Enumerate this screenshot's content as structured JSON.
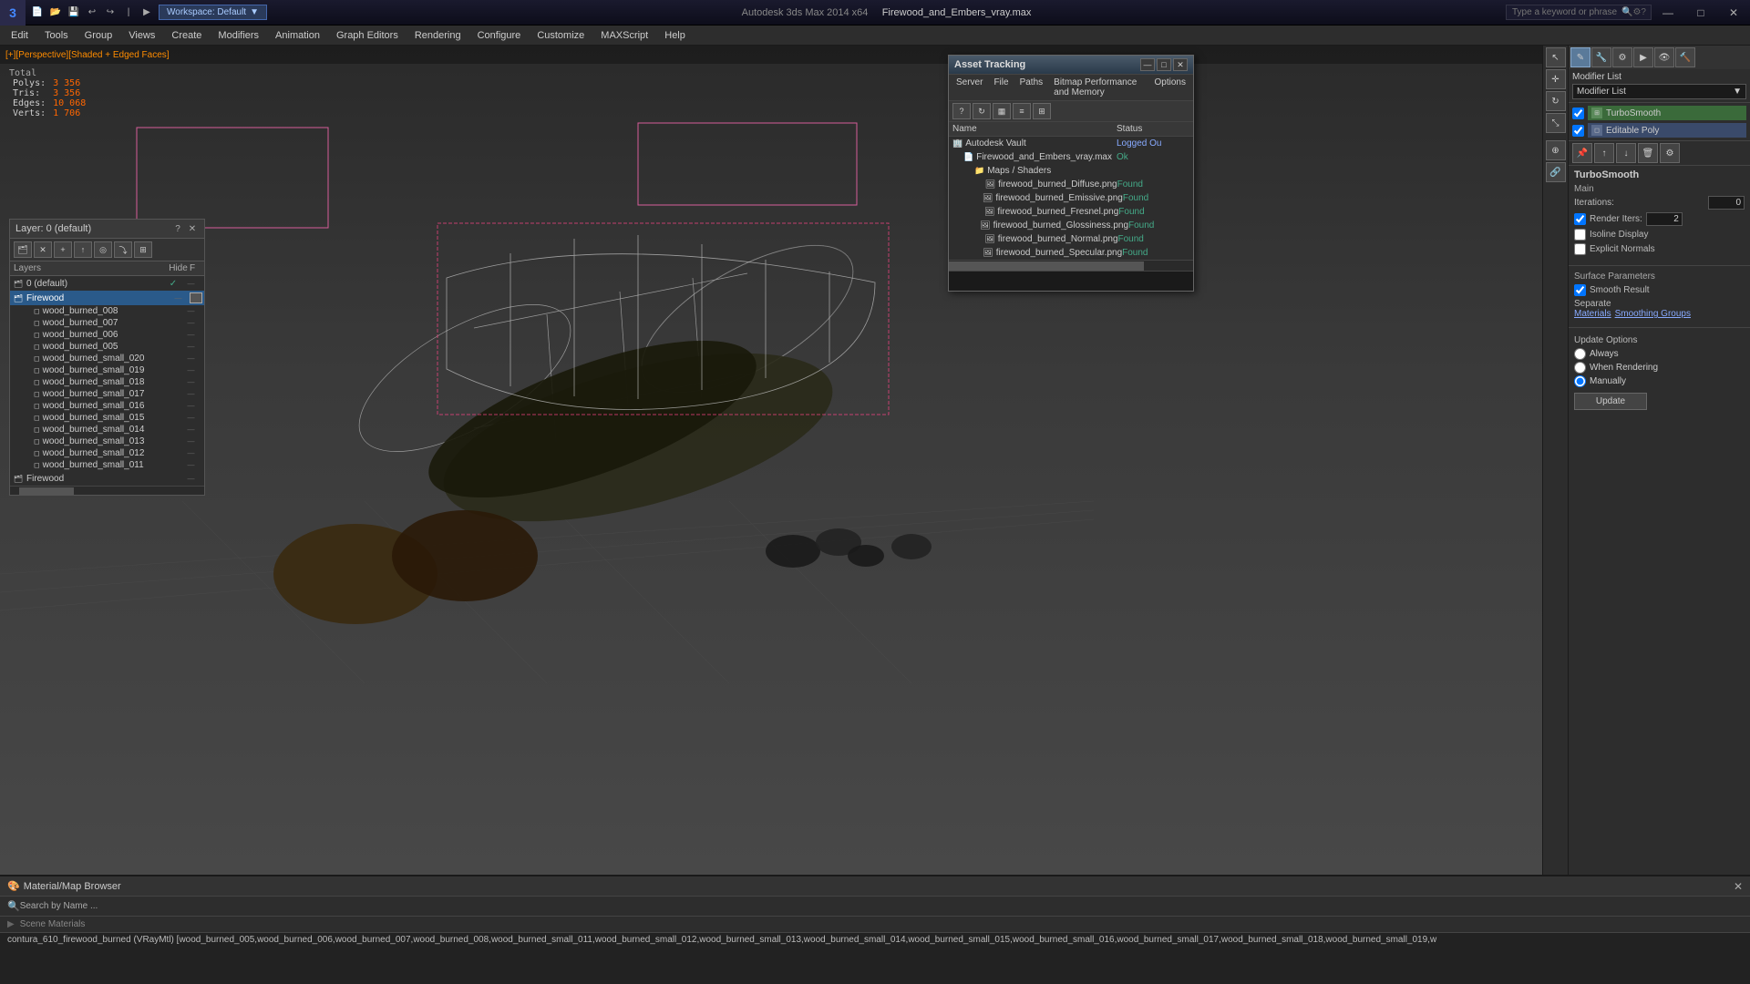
{
  "titlebar": {
    "app_icon": "3",
    "app_title": "Autodesk 3ds Max 2014 x64",
    "file_name": "Firewood_and_Embers_vray.max",
    "workspace_label": "Workspace: Default",
    "search_placeholder": "Type a keyword or phrase",
    "min_btn": "—",
    "max_btn": "□",
    "close_btn": "✕"
  },
  "menubar": {
    "items": [
      "Edit",
      "Tools",
      "Group",
      "Views",
      "Create",
      "Modifiers",
      "Animation",
      "Graph Editors",
      "Rendering",
      "Configure",
      "Customize",
      "MAXScript",
      "Help"
    ]
  },
  "viewport": {
    "header": "[+][Perspective][Shaded + Edged Faces]",
    "stats": {
      "polys_label": "Polys:",
      "polys_value": "3 356",
      "tris_label": "Tris:",
      "tris_value": "3 356",
      "edges_label": "Edges:",
      "edges_value": "10 068",
      "verts_label": "Verts:",
      "verts_value": "1 706",
      "total_label": "Total"
    }
  },
  "layer_panel": {
    "title": "Layer: 0 (default)",
    "columns": {
      "layers": "Layers",
      "hide": "Hide",
      "f": "F"
    },
    "items": [
      {
        "name": "0 (default)",
        "depth": 0,
        "type": "layer",
        "checked": true
      },
      {
        "name": "Firewood",
        "depth": 0,
        "type": "layer",
        "selected": true
      },
      {
        "name": "wood_burned_008",
        "depth": 1,
        "type": "object"
      },
      {
        "name": "wood_burned_007",
        "depth": 1,
        "type": "object"
      },
      {
        "name": "wood_burned_006",
        "depth": 1,
        "type": "object"
      },
      {
        "name": "wood_burned_005",
        "depth": 1,
        "type": "object"
      },
      {
        "name": "wood_burned_small_020",
        "depth": 1,
        "type": "object"
      },
      {
        "name": "wood_burned_small_019",
        "depth": 1,
        "type": "object"
      },
      {
        "name": "wood_burned_small_018",
        "depth": 1,
        "type": "object"
      },
      {
        "name": "wood_burned_small_017",
        "depth": 1,
        "type": "object"
      },
      {
        "name": "wood_burned_small_016",
        "depth": 1,
        "type": "object"
      },
      {
        "name": "wood_burned_small_015",
        "depth": 1,
        "type": "object"
      },
      {
        "name": "wood_burned_small_014",
        "depth": 1,
        "type": "object"
      },
      {
        "name": "wood_burned_small_013",
        "depth": 1,
        "type": "object"
      },
      {
        "name": "wood_burned_small_012",
        "depth": 1,
        "type": "object"
      },
      {
        "name": "wood_burned_small_011",
        "depth": 1,
        "type": "object"
      },
      {
        "name": "Firewood",
        "depth": 0,
        "type": "layer"
      }
    ]
  },
  "asset_tracking": {
    "title": "Asset Tracking",
    "menu_items": [
      "Server",
      "File",
      "Paths",
      "Bitmap Performance and Memory",
      "Options"
    ],
    "columns": {
      "name": "Name",
      "status": "Status"
    },
    "tree": [
      {
        "name": "Autodesk Vault",
        "depth": 0,
        "status": "Logged Ou",
        "icon": "🏢"
      },
      {
        "name": "Firewood_and_Embers_vray.max",
        "depth": 1,
        "status": "Ok",
        "icon": "📄"
      },
      {
        "name": "Maps / Shaders",
        "depth": 2,
        "status": "",
        "icon": "📁"
      },
      {
        "name": "firewood_burned_Diffuse.png",
        "depth": 3,
        "status": "Found",
        "icon": "🖼"
      },
      {
        "name": "firewood_burned_Emissive.png",
        "depth": 3,
        "status": "Found",
        "icon": "🖼"
      },
      {
        "name": "firewood_burned_Fresnel.png",
        "depth": 3,
        "status": "Found",
        "icon": "🖼"
      },
      {
        "name": "firewood_burned_Glossiness.png",
        "depth": 3,
        "status": "Found",
        "icon": "🖼"
      },
      {
        "name": "firewood_burned_Normal.png",
        "depth": 3,
        "status": "Found",
        "icon": "🖼"
      },
      {
        "name": "firewood_burned_Specular.png",
        "depth": 3,
        "status": "Found",
        "icon": "🖼"
      }
    ]
  },
  "modifier_panel": {
    "modifier_list_label": "Modifier List",
    "modifier_dropdown_text": "Modifier List",
    "stack": [
      {
        "name": "TurboSmooth",
        "type": "modifier"
      },
      {
        "name": "Editable Poly",
        "type": "base"
      }
    ],
    "turbosm": {
      "title": "TurboSmooth",
      "main_label": "Main",
      "iterations_label": "Iterations:",
      "iterations_value": "0",
      "render_iters_label": "Render Iters:",
      "render_iters_value": "2",
      "isoline_label": "Isoline Display",
      "explicit_label": "Explicit Normals",
      "surface_label": "Surface Parameters",
      "smooth_label": "Smooth Result",
      "separate_label": "Separate",
      "materials_label": "Materials",
      "smoothing_label": "Smoothing Groups",
      "update_label": "Update Options",
      "always_label": "Always",
      "when_rendering_label": "When Rendering",
      "manually_label": "Manually",
      "update_btn": "Update"
    }
  },
  "right_toolbar": {
    "buttons": [
      "☰",
      "✎",
      "🔧",
      "📐",
      "🔵",
      "⚙"
    ]
  },
  "material_browser": {
    "title": "Material/Map Browser",
    "search_label": "Search by Name ...",
    "scene_materials_label": "Scene Materials",
    "material_list": "contura_610_firewood_burned (VRayMtl) [wood_burned_005,wood_burned_006,wood_burned_007,wood_burned_008,wood_burned_small_011,wood_burned_small_012,wood_burned_small_013,wood_burned_small_014,wood_burned_small_015,wood_burned_small_016,wood_burned_small_017,wood_burned_small_018,wood_burned_small_019,w"
  },
  "colors": {
    "accent_orange": "#ff6600",
    "accent_blue": "#4488ff",
    "selected_blue": "#2a5a8a",
    "found_green": "#4aaa44",
    "bg_dark": "#2d2d2d",
    "bg_darker": "#1a1a1a",
    "border": "#555555"
  }
}
